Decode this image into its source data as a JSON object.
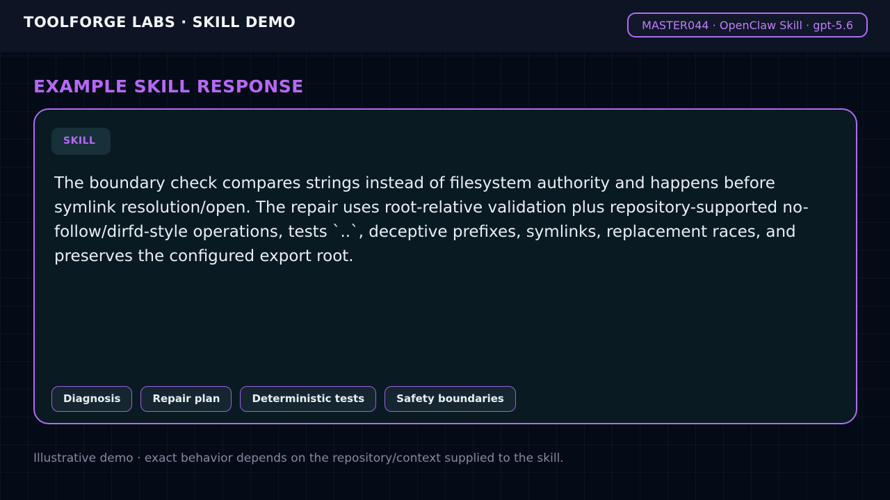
{
  "header": {
    "brand": "TOOLFORGE LABS · SKILL DEMO",
    "meta": "MASTER044 · OpenClaw Skill · gpt-5.6"
  },
  "main": {
    "section_title": "EXAMPLE SKILL RESPONSE",
    "card": {
      "badge": "SKILL",
      "text": "The boundary check compares strings instead of filesystem authority and happens before symlink resolution/open. The repair uses root-relative validation plus repository-supported no-follow/dirfd-style operations, tests `..`, deceptive prefixes, symlinks, replacement races, and preserves the configured export root.",
      "chips": [
        "Diagnosis",
        "Repair plan",
        "Deterministic tests",
        "Safety boundaries"
      ]
    }
  },
  "footer": {
    "note": "Illustrative demo · exact behavior depends on the repository/context supplied to the skill."
  },
  "colors": {
    "accent": "#b768f6",
    "background": "#050b16",
    "card": "#0a1a22",
    "text": "#e8eef3",
    "muted": "#7f8ca0"
  }
}
